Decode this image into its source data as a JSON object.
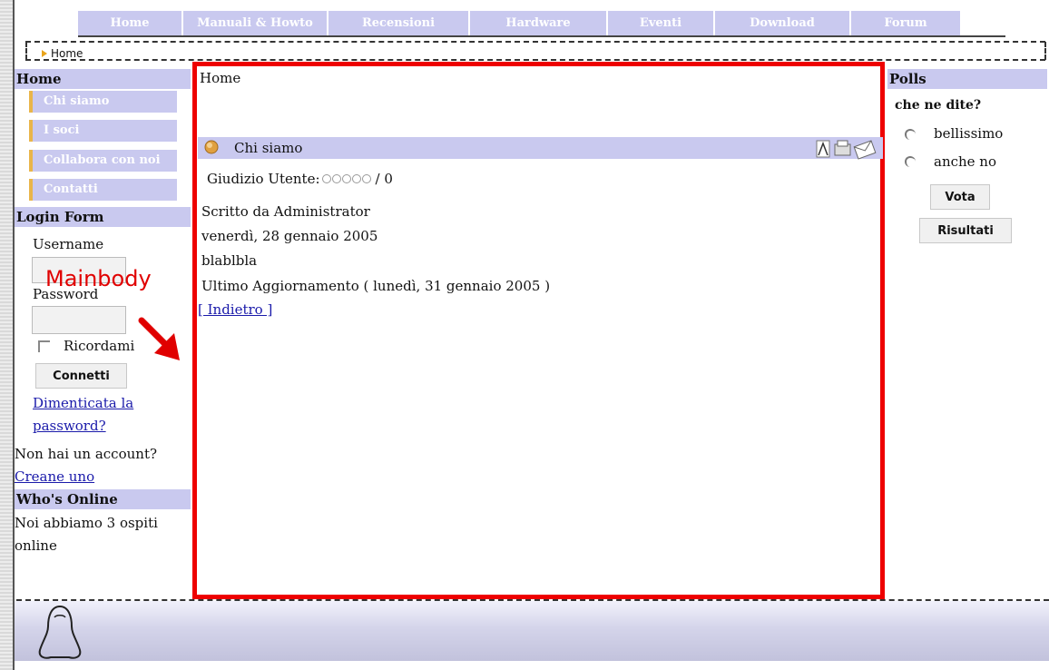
{
  "nav": {
    "tabs": [
      {
        "label": "Home"
      },
      {
        "label": "Manuali & Howto"
      },
      {
        "label": "Recensioni"
      },
      {
        "label": "Hardware"
      },
      {
        "label": "Eventi"
      },
      {
        "label": "Download"
      },
      {
        "label": "Forum"
      }
    ]
  },
  "breadcrumb": {
    "label": "Home"
  },
  "sidebar": {
    "menu_title": "Home",
    "menu_items": [
      {
        "label": "Chi siamo"
      },
      {
        "label": "I soci"
      },
      {
        "label": "Collabora con noi"
      },
      {
        "label": "Contatti"
      }
    ],
    "login": {
      "title": "Login Form",
      "username_label": "Username",
      "password_label": "Password",
      "remember_label": "Ricordami",
      "submit_label": "Connetti",
      "forgot_line1": "Dimenticata la",
      "forgot_line2": "password?",
      "no_account": "Non hai un account?",
      "create": "Creane uno"
    },
    "online": {
      "title": "Who's Online",
      "line1": "Noi abbiamo 3 ospiti",
      "line2": "online"
    }
  },
  "main": {
    "pathway": "Home",
    "article_title": "Chi siamo",
    "rating_label": "Giudizio Utente:",
    "rating_value": "/ 0",
    "rating_stars": 0,
    "author": "Scritto da Administrator",
    "date": "venerdì, 28 gennaio 2005",
    "body": "blablbla",
    "updated": "Ultimo Aggiornamento ( lunedì, 31 gennaio 2005 )",
    "back_link": "[ Indietro ]"
  },
  "polls": {
    "title": "Polls",
    "question": "che ne dite?",
    "options": [
      {
        "label": "bellissimo"
      },
      {
        "label": "anche no"
      }
    ],
    "vote_label": "Vota",
    "results_label": "Risultati"
  },
  "annotation": {
    "label": "Mainbody"
  },
  "colors": {
    "accent": "#c9c9ef",
    "highlight_box": "#ee0000",
    "menu_border": "#e9b54a",
    "link": "#1a1aaa"
  }
}
